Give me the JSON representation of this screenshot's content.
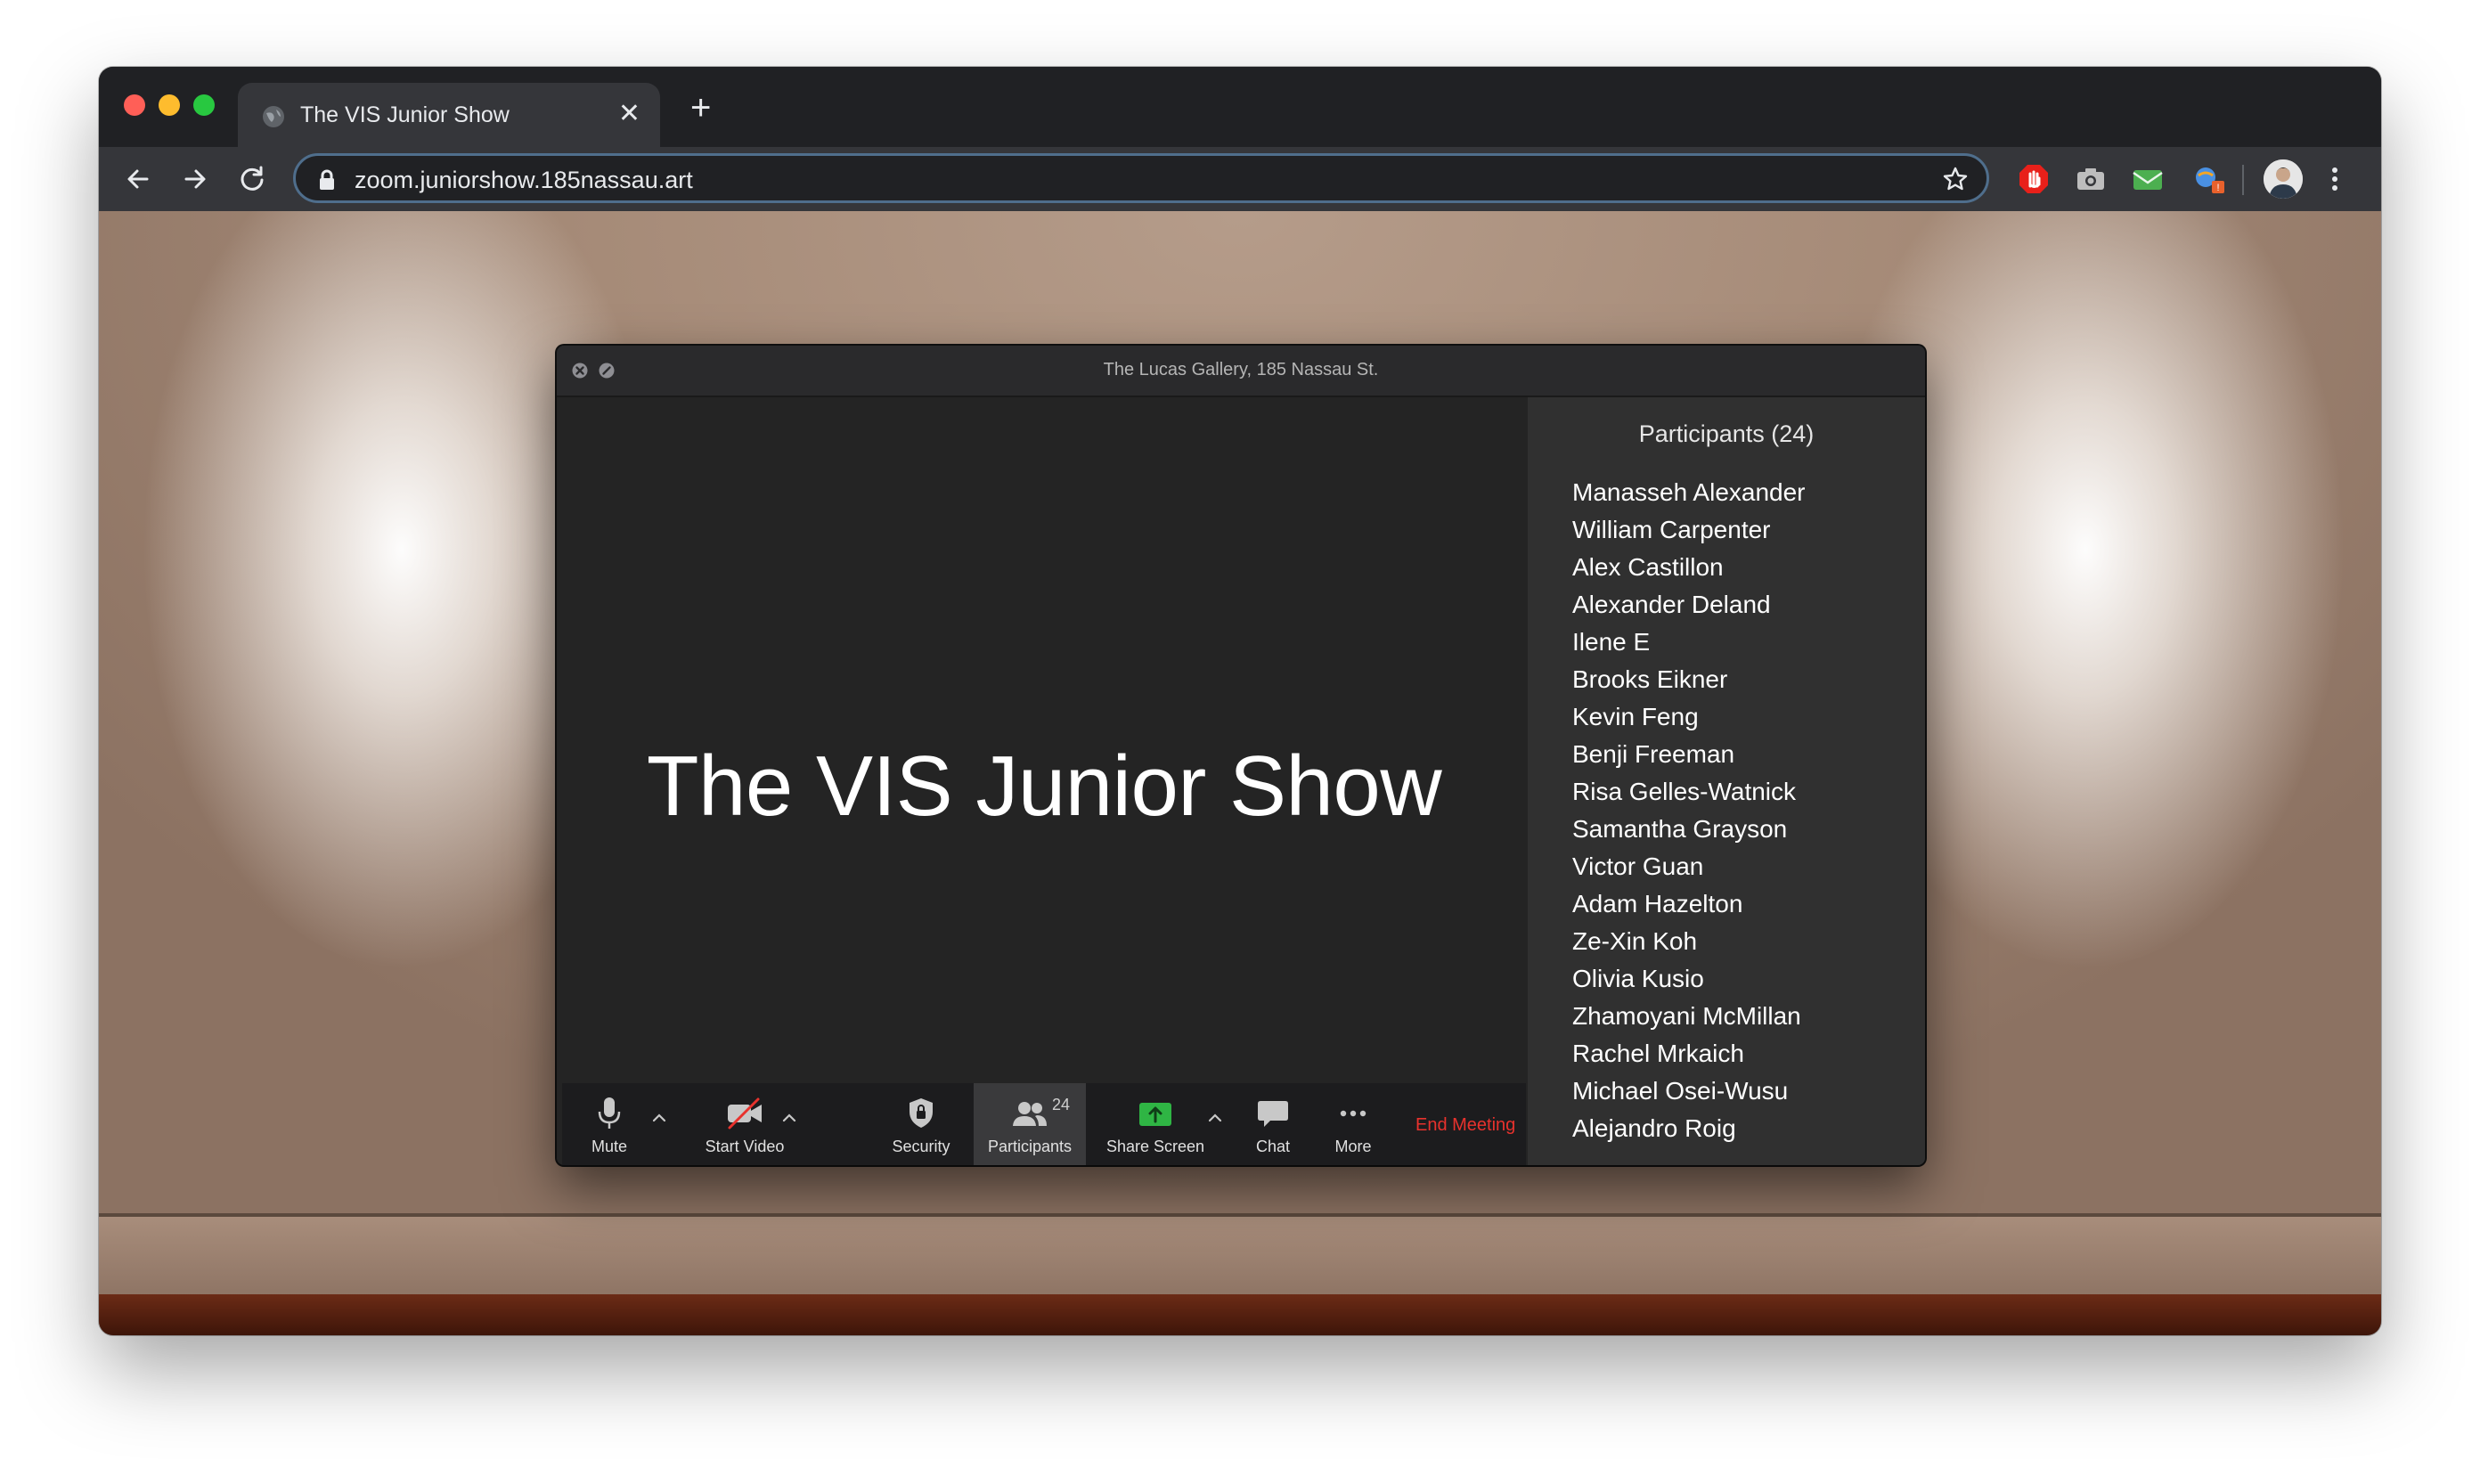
{
  "browser": {
    "tab_title": "The VIS Junior Show",
    "url": "zoom.juniorshow.185nassau.art",
    "icons": [
      "back-icon",
      "forward-icon",
      "reload-icon",
      "lock-icon",
      "star-icon",
      "new-tab-icon",
      "tab-close-icon",
      "more-menu-icon"
    ],
    "extensions": [
      "adblock-extension-icon",
      "camera-extension-icon",
      "mail-extension-icon",
      "translate-extension-icon"
    ]
  },
  "zoom": {
    "window_title": "The Lucas Gallery, 185 Nassau St.",
    "share_title": "The VIS Junior Show",
    "toolbar": {
      "mute": "Mute",
      "start_video": "Start Video",
      "security": "Security",
      "participants": "Participants",
      "participants_count": "24",
      "share_screen": "Share Screen",
      "chat": "Chat",
      "more": "More",
      "end_meeting": "End Meeting"
    },
    "panel": {
      "title": "Participants (24)",
      "participants": [
        "Manasseh Alexander",
        "William Carpenter",
        "Alex Castillon",
        "Alexander Deland",
        "Ilene E",
        "Brooks Eikner",
        "Kevin Feng",
        "Benji Freeman",
        "Risa Gelles-Watnick",
        "Samantha Grayson",
        "Victor Guan",
        "Adam Hazelton",
        "Ze-Xin Koh",
        "Olivia Kusio",
        "Zhamoyani McMillan",
        "Rachel Mrkaich",
        "Michael Osei-Wusu",
        "Alejandro Roig"
      ]
    }
  },
  "colors": {
    "accent_end_meeting": "#e8322d",
    "share_screen_green": "#2fb544",
    "toolbar_bg": "#1c1c1e"
  }
}
